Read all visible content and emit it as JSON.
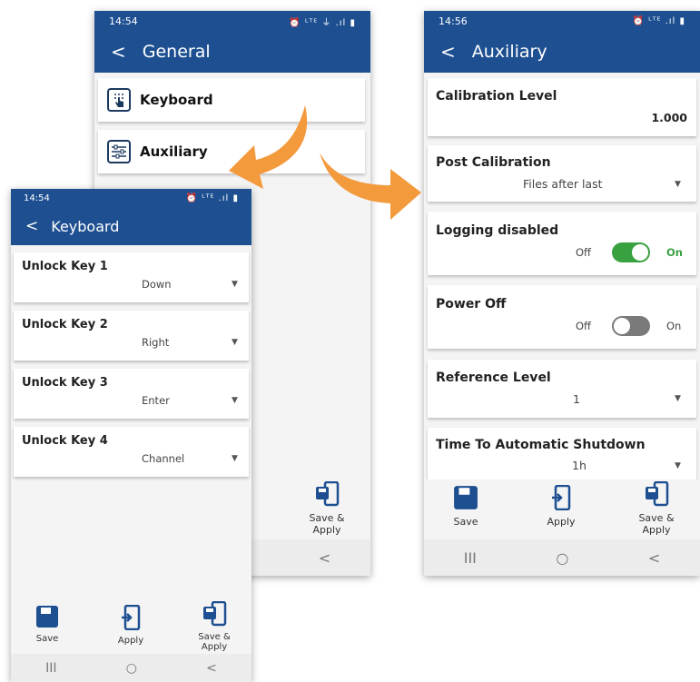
{
  "colors": {
    "brand": "#1d4f91",
    "toggle_on": "#3aa141",
    "toggle_off": "#7a7a7a",
    "on_label": "#3aa141",
    "arrow": "#f39a3d"
  },
  "general_screen": {
    "status_time": "14:54",
    "status_right": "⏰ ᴸᵀᴱ ⏚ .ıl ▮",
    "title": "General",
    "items": [
      {
        "label": "Keyboard",
        "icon": "keyboard-touch-icon"
      },
      {
        "label": "Auxiliary",
        "icon": "sliders-icon"
      }
    ],
    "save_apply_label": [
      "Save &",
      "Apply"
    ]
  },
  "keyboard_screen": {
    "status_time": "14:54",
    "status_right": "⏰ ᴸᵀᴱ .ıl ▮",
    "title": "Keyboard",
    "items": [
      {
        "title": "Unlock Key 1",
        "value": "Down"
      },
      {
        "title": "Unlock Key 2",
        "value": "Right"
      },
      {
        "title": "Unlock Key 3",
        "value": "Enter"
      },
      {
        "title": "Unlock Key 4",
        "value": "Channel"
      }
    ],
    "actions": {
      "save": "Save",
      "apply": "Apply",
      "save_apply_1": "Save &",
      "save_apply_2": "Apply"
    }
  },
  "auxiliary_screen": {
    "status_time": "14:56",
    "status_right": "⏰ ᴸᵀᴱ .ıl ▮",
    "title": "Auxiliary",
    "calibration_level": {
      "title": "Calibration Level",
      "value": "1.000"
    },
    "post_calibration": {
      "title": "Post Calibration",
      "value": "Files after last"
    },
    "logging": {
      "title": "Logging disabled",
      "off": "Off",
      "on": "On",
      "state": true
    },
    "power_off": {
      "title": "Power Off",
      "off": "Off",
      "on": "On",
      "state": false
    },
    "reference_level": {
      "title": "Reference Level",
      "value": "1"
    },
    "shutdown": {
      "title": "Time To Automatic Shutdown",
      "value": "1h"
    },
    "actions": {
      "save": "Save",
      "apply": "Apply",
      "save_apply_1": "Save &",
      "save_apply_2": "Apply"
    }
  },
  "nav": {
    "recents": "III",
    "home": "○",
    "back": "<"
  }
}
